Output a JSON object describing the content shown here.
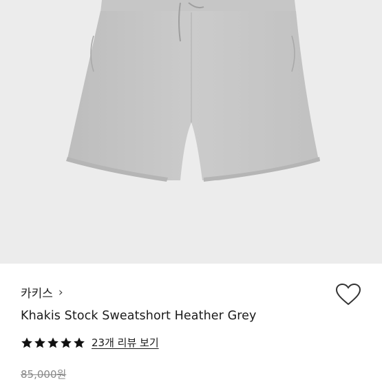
{
  "product": {
    "image_alt": "heather grey sweatshorts",
    "brand_name": "카키스",
    "brand_chevron": "›",
    "title": "Khakis Stock Sweatshort Heather Grey",
    "rating_stars": 5,
    "review_link_label": "23개 리뷰 보기",
    "original_price": "85,000원",
    "wishlist_icon": "heart-outline-icon",
    "colors": {
      "photo_bg": "#ececec",
      "shorts": "#c8c8c8",
      "star": "#111111",
      "price_strike": "#888888"
    }
  }
}
